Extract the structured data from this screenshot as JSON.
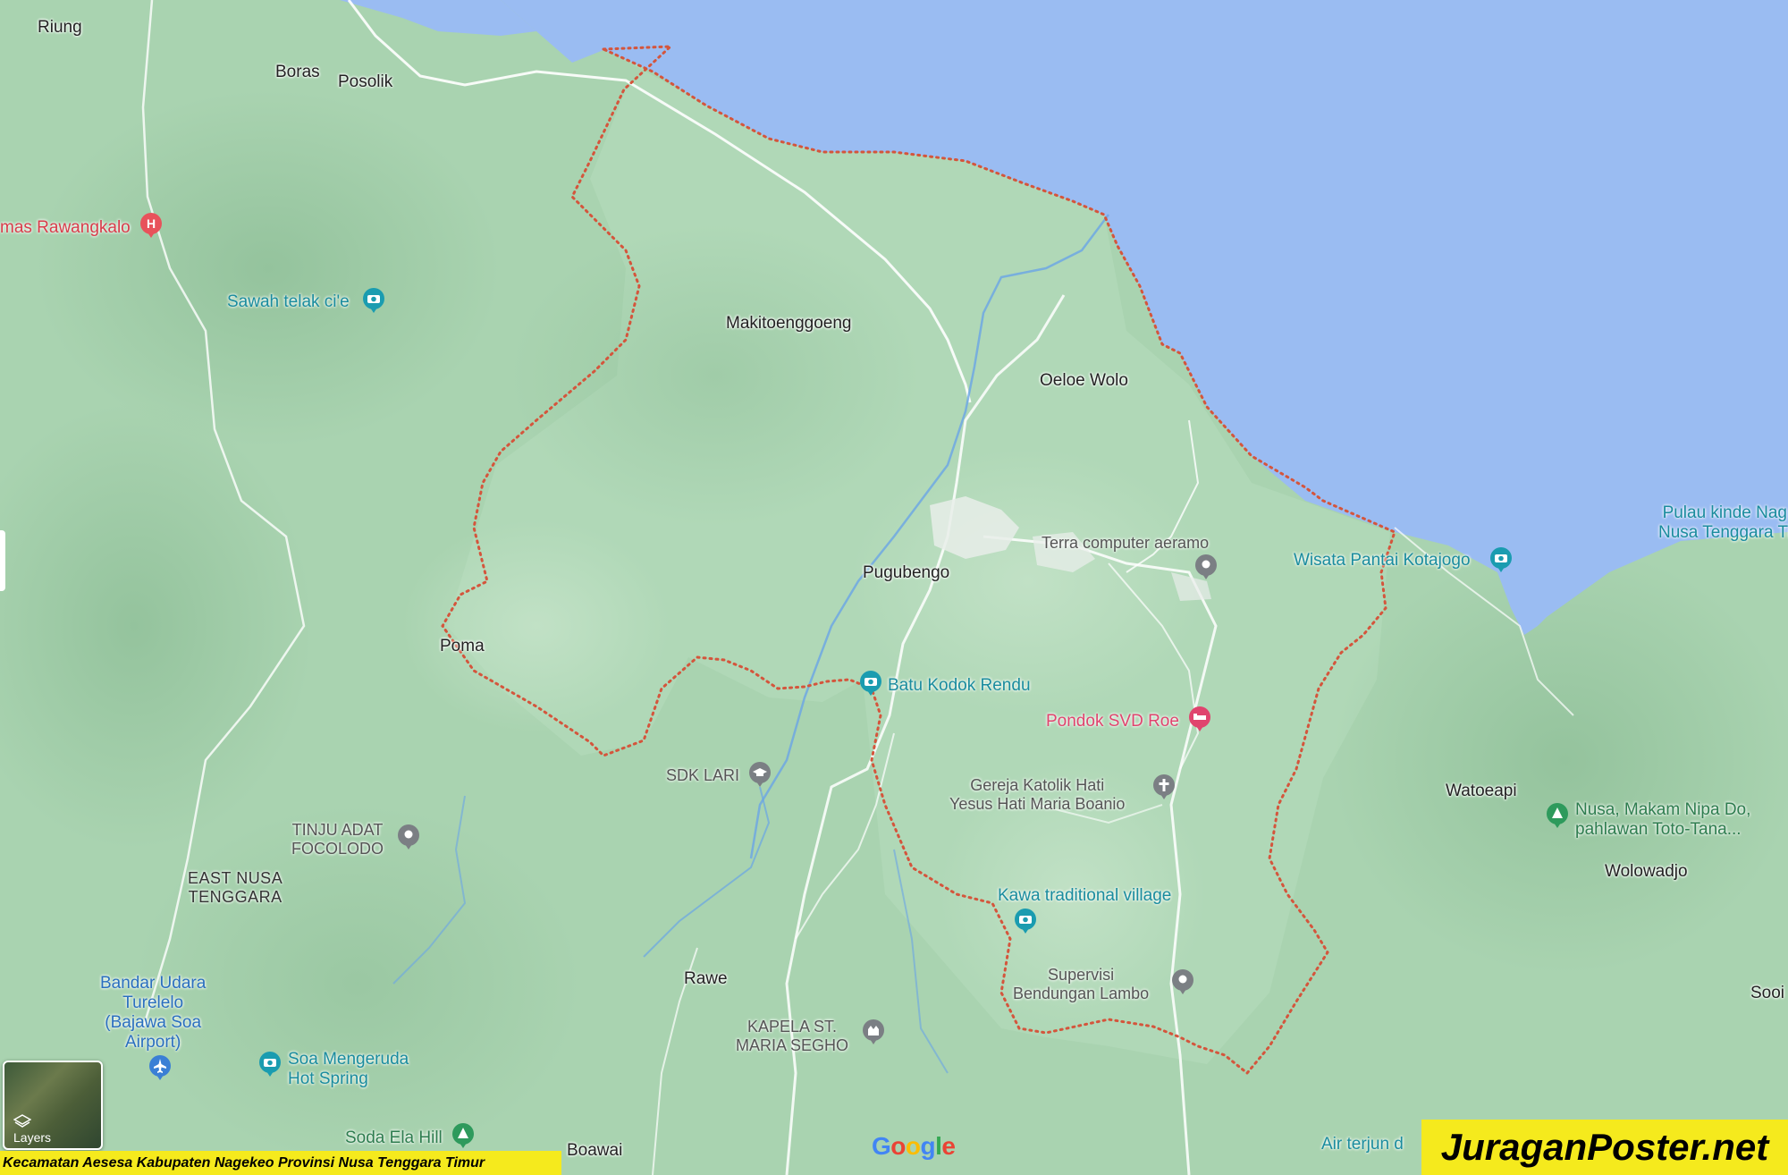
{
  "map": {
    "colors": {
      "land": "#a9d3b0",
      "water": "#9abcf2",
      "boundary": "#d4553c",
      "road": "#ffffff",
      "river": "#6aa5e6"
    },
    "places": {
      "riung": "Riung",
      "boras": "Boras",
      "posolik": "Posolik",
      "makitoenggoeng": "Makitoenggoeng",
      "oeloe_wolo": "Oeloe Wolo",
      "pugubengo": "Pugubengo",
      "poma": "Poma",
      "watoeapi": "Watoeapi",
      "wolowadjo": "Wolowadjo",
      "rawe": "Rawe",
      "boawai": "Boawai",
      "sooi": "Sooi"
    },
    "region": {
      "line1": "EAST NUSA",
      "line2": "TENGGARA"
    },
    "pois": {
      "rawangkalo": "mas Rawangkalo",
      "sawah": "Sawah telak ci'e",
      "terra": "Terra computer aeramo",
      "wisata": "Wisata Pantai Kotajogo",
      "pulau_1": "Pulau kinde Nag",
      "pulau_2": "Nusa Tenggara Ti",
      "batu": "Batu Kodok Rendu",
      "pondok": "Pondok SVD Roe",
      "sdk": "SDK LARI",
      "gereja_1": "Gereja Katolik Hati",
      "gereja_2": "Yesus Hati Maria Boanio",
      "tinju_1": "TINJU ADAT",
      "tinju_2": "FOCOLODO",
      "nusa_1": "Nusa, Makam Nipa Do,",
      "nusa_2": "pahlawan Toto-Tana...",
      "kawa": "Kawa traditional village",
      "supervisi_1": "Supervisi",
      "supervisi_2": "Bendungan Lambo",
      "bandar_1": "Bandar Udara",
      "bandar_2": "Turelelo",
      "bandar_3": "(Bajawa Soa",
      "bandar_4": "Airport)",
      "kapela_1": "KAPELA ST.",
      "kapela_2": "MARIA SEGHO",
      "soa_1": "Soa Mengeruda",
      "soa_2": "Hot Spring",
      "soda": "Soda Ela Hill",
      "air": "Air terjun d"
    },
    "icons": {
      "hospital": "hospital-icon",
      "camera": "camera-icon",
      "pin": "pin-icon",
      "hotel": "hotel-icon",
      "school": "school-icon",
      "church": "church-icon",
      "chapel": "chapel-icon",
      "plane": "plane-icon",
      "park": "park-icon"
    }
  },
  "controls": {
    "layers_label": "Layers",
    "google_logo": "Google"
  },
  "caption": "Kecamatan Aesesa Kabupaten Nagekeo Provinsi Nusa Tenggara Timur",
  "watermark": "JuraganPoster.net"
}
